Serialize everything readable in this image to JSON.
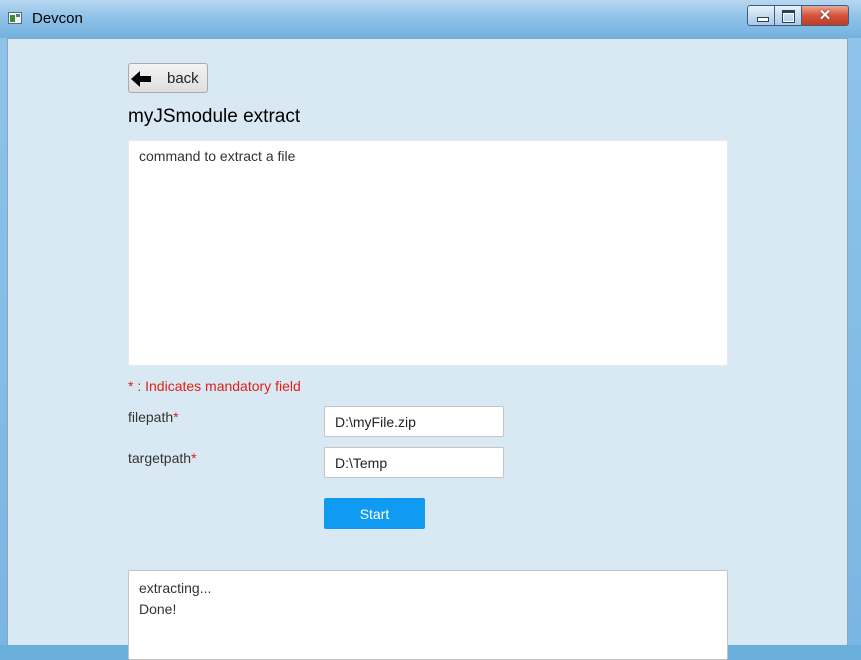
{
  "window": {
    "title": "Devcon",
    "controls": {
      "minimize": "minimize-icon",
      "maximize": "maximize-icon",
      "close": "✕"
    }
  },
  "nav": {
    "back_label": "back",
    "back_icon": "arrow-left-icon"
  },
  "module": {
    "title": "myJSmodule extract",
    "description": "command to extract a file"
  },
  "form": {
    "mandatory_note": "* : Indicates mandatory field",
    "required_marker": "*",
    "fields": [
      {
        "label": "filepath",
        "value": "D:\\myFile.zip"
      },
      {
        "label": "targetpath",
        "value": "D:\\Temp"
      }
    ],
    "start_label": "Start"
  },
  "output": {
    "lines": [
      "extracting...",
      "Done!"
    ]
  },
  "colors": {
    "accent": "#0f9bf2",
    "required": "#e0201a",
    "background": "#d9e9f3"
  }
}
